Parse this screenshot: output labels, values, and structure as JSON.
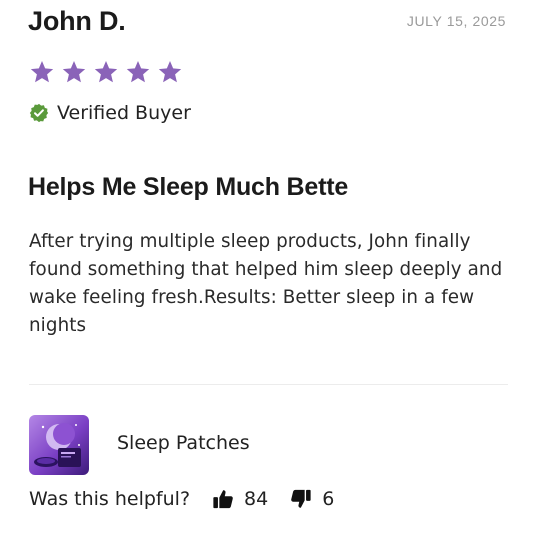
{
  "review": {
    "reviewer_name": "John D.",
    "date": "JULY 15, 2025",
    "rating": 5,
    "rating_max": 5,
    "star_color": "#8a63b8",
    "verified_label": "Verified Buyer",
    "verified_icon": "check-badge-icon",
    "verified_color": "#5a9a3b",
    "title": "Helps Me Sleep Much Bette",
    "body": "After trying multiple sleep products, John finally found something that helped him sleep deeply and wake feeling fresh.Results: Better sleep in a few nights"
  },
  "product": {
    "name": "Sleep Patches",
    "thumbnail_icon": "product-thumbnail"
  },
  "helpful": {
    "question": "Was this helpful?",
    "upvotes": "84",
    "downvotes": "6",
    "upvote_icon": "thumbs-up-icon",
    "downvote_icon": "thumbs-down-icon"
  }
}
